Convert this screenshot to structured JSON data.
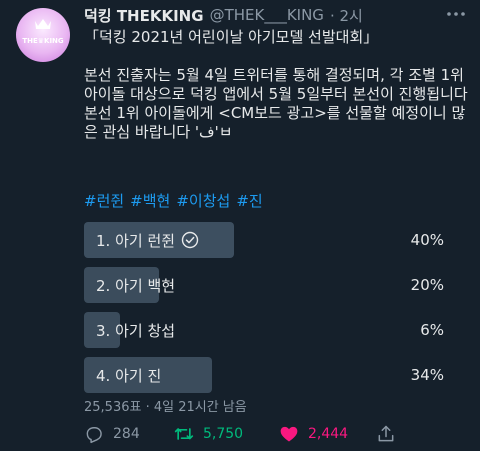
{
  "author": {
    "display_name": "덕킹 THEKKING",
    "handle": "@THEK___KING",
    "time": "· 2시",
    "avatar_text": "THE♛KING"
  },
  "body_text": "「덕킹 2021년 어린이날 아기모델 선발대회」\n\n본선 진출자는 5월 4일 트위터를 통해 결정되며, 각 조별 1위 아이돌 대상으로 덕킹 앱에서 5월 5일부터 본선이 진행됩니다\n본선 1위 아이돌에게 <CM보드 광고>를 선물할 예정이니 많은 관심 바랍니다 'ف'ㅂ",
  "hashtags": [
    "#런쥔",
    "#백현",
    "#이창섭",
    "#진"
  ],
  "poll": {
    "options": [
      {
        "label": "1. 아기 런쥔",
        "percent_text": "40%",
        "percent": 40,
        "winner": true
      },
      {
        "label": "2. 아기 백현",
        "percent_text": "20%",
        "percent": 20,
        "winner": false
      },
      {
        "label": "3. 아기 창섭",
        "percent_text": "6%",
        "percent": 6,
        "winner": false
      },
      {
        "label": "4. 아기 진",
        "percent_text": "34%",
        "percent": 34,
        "winner": false
      }
    ],
    "meta": "25,536표 · 4일 21시간 남음"
  },
  "actions": {
    "reply_count": "284",
    "retweet_count": "5,750",
    "like_count": "2,444"
  },
  "colors": {
    "background": "#15202b",
    "text": "#e7e9ea",
    "muted": "#8b98a5",
    "link": "#1d9bf0",
    "retweet": "#00ba7c",
    "like": "#f91880",
    "poll_bar": "#3b4c5c"
  }
}
